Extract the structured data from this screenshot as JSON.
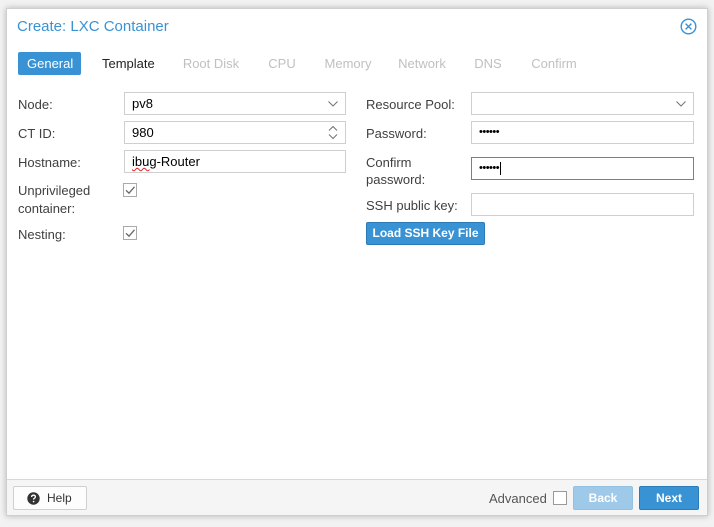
{
  "dialog": {
    "title": "Create: LXC Container"
  },
  "tabs": [
    {
      "label": "General",
      "state": "active"
    },
    {
      "label": "Template",
      "state": "enabled"
    },
    {
      "label": "Root Disk",
      "state": "disabled"
    },
    {
      "label": "CPU",
      "state": "disabled"
    },
    {
      "label": "Memory",
      "state": "disabled"
    },
    {
      "label": "Network",
      "state": "disabled"
    },
    {
      "label": "DNS",
      "state": "disabled"
    },
    {
      "label": "Confirm",
      "state": "disabled"
    }
  ],
  "left": {
    "node_label": "Node:",
    "node_value": "pv8",
    "ctid_label": "CT ID:",
    "ctid_value": "980",
    "hostname_label": "Hostname:",
    "hostname_value_misspelled": "ibug",
    "hostname_value_rest": "-Router",
    "unpriv_label_1": "Unprivileged",
    "unpriv_label_2": "container:",
    "unpriv_checked": true,
    "nesting_label": "Nesting:",
    "nesting_checked": true
  },
  "right": {
    "pool_label": "Resource Pool:",
    "pool_value": "",
    "password_label": "Password:",
    "password_value": "••••••",
    "confirm_label_1": "Confirm",
    "confirm_label_2": "password:",
    "confirm_value": "••••••",
    "ssh_label": "SSH public key:",
    "ssh_value": "",
    "load_ssh_button": "Load SSH Key File"
  },
  "footer": {
    "help_label": "Help",
    "advanced_label": "Advanced",
    "advanced_checked": false,
    "back_label": "Back",
    "next_label": "Next"
  },
  "colors": {
    "accent": "#3892d4",
    "accent_disabled": "#9ec9e8",
    "tab_disabled_text": "#c0c0c0",
    "spellcheck": "#e02020"
  },
  "icons": {
    "close": "close-circle-icon",
    "dropdown": "chevron-down-icon",
    "spinner": "spinner-updown-icon",
    "checkbox": "checkmark-icon",
    "help": "question-circle-icon"
  }
}
